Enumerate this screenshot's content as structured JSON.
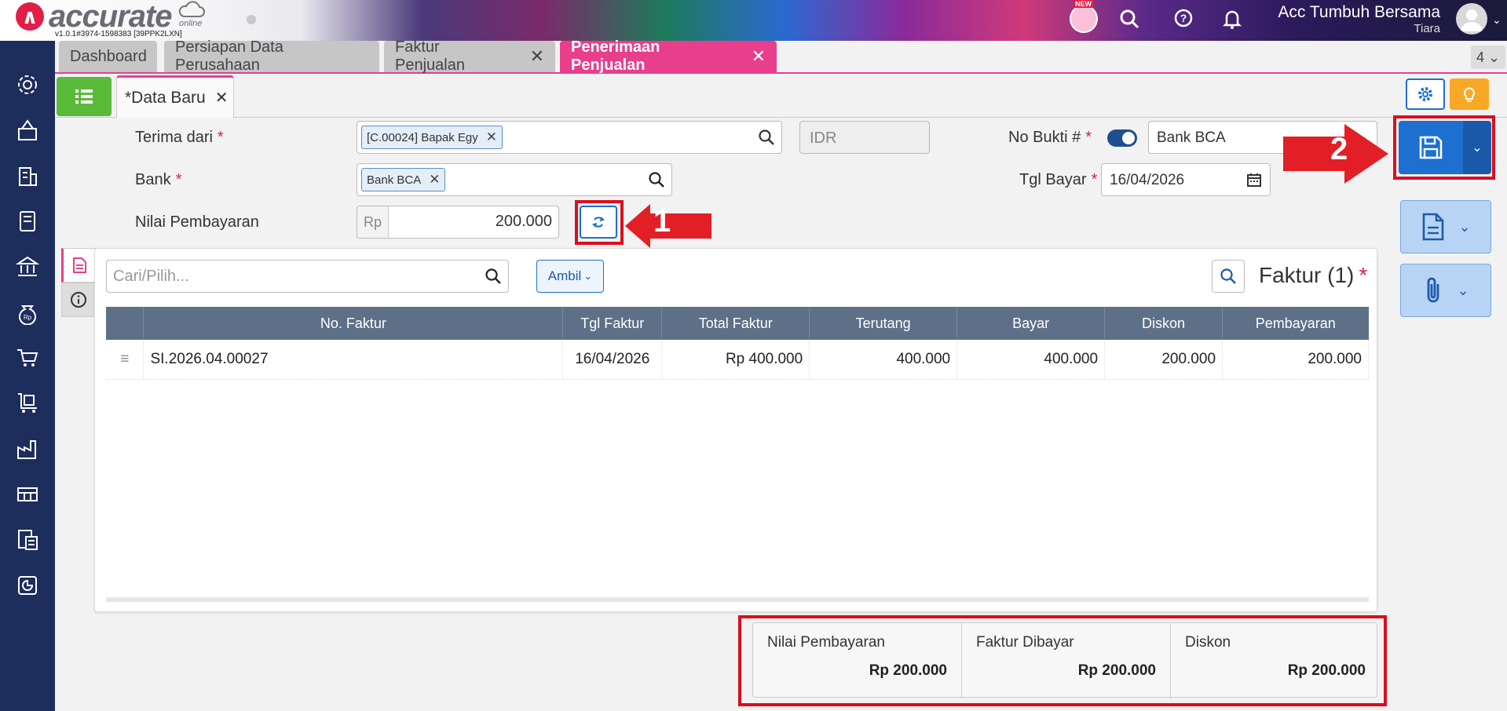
{
  "app": {
    "brand": "accurate",
    "brand_suffix": "online",
    "version": "v1.0.1#3974-1598383 [39PPK2LXN]",
    "new_badge": "NEW",
    "company": "Acc Tumbuh Bersama",
    "user": "Tiara"
  },
  "tabs": [
    {
      "label": "Dashboard",
      "closable": false
    },
    {
      "label": "Persiapan Data Perusahaan",
      "closable": false
    },
    {
      "label": "Faktur Penjualan",
      "closable": true
    },
    {
      "label": "Penerimaan Penjualan",
      "closable": true,
      "active": true
    }
  ],
  "tab_count": "4",
  "doc_tab": {
    "label": "*Data Baru"
  },
  "form": {
    "terima_dari_label": "Terima dari",
    "customer_chip": "[C.00024] Bapak Egy",
    "currency": "IDR",
    "no_bukti_label": "No Bukti #",
    "no_bukti_value": "Bank BCA",
    "bank_label": "Bank",
    "bank_chip": "Bank BCA",
    "tgl_bayar_label": "Tgl Bayar",
    "tgl_bayar_value": "16/04/2026",
    "nilai_label": "Nilai Pembayaran",
    "rp_prefix": "Rp",
    "nilai_value": "200.000"
  },
  "annotations": {
    "step1": "1",
    "step2": "2"
  },
  "detail": {
    "search_placeholder": "Cari/Pilih...",
    "ambil_label": "Ambil",
    "faktur_title": "Faktur (1)",
    "columns": [
      "No. Faktur",
      "Tgl Faktur",
      "Total Faktur",
      "Terutang",
      "Bayar",
      "Diskon",
      "Pembayaran"
    ],
    "rows": [
      [
        "SI.2026.04.00027",
        "16/04/2026",
        "Rp 400.000",
        "400.000",
        "400.000",
        "200.000",
        "200.000"
      ]
    ]
  },
  "summary": {
    "nilai_label": "Nilai Pembayaran",
    "nilai_value": "Rp 200.000",
    "faktur_label": "Faktur Dibayar",
    "faktur_value": "Rp 200.000",
    "diskon_label": "Diskon",
    "diskon_value": "Rp 200.000"
  },
  "colors": {
    "accent": "#e83e8c",
    "primary": "#1d6fd0",
    "sidebar": "#1d2d5c",
    "highlight": "#d90f1f"
  },
  "sidebar_icons": [
    "settings-icon",
    "company-icon",
    "building-icon",
    "ledger-icon",
    "bank-icon",
    "money-bag-icon",
    "cart-icon",
    "shopping-trolley-icon",
    "factory-icon",
    "warehouse-icon",
    "tax-icon",
    "report-icon"
  ]
}
